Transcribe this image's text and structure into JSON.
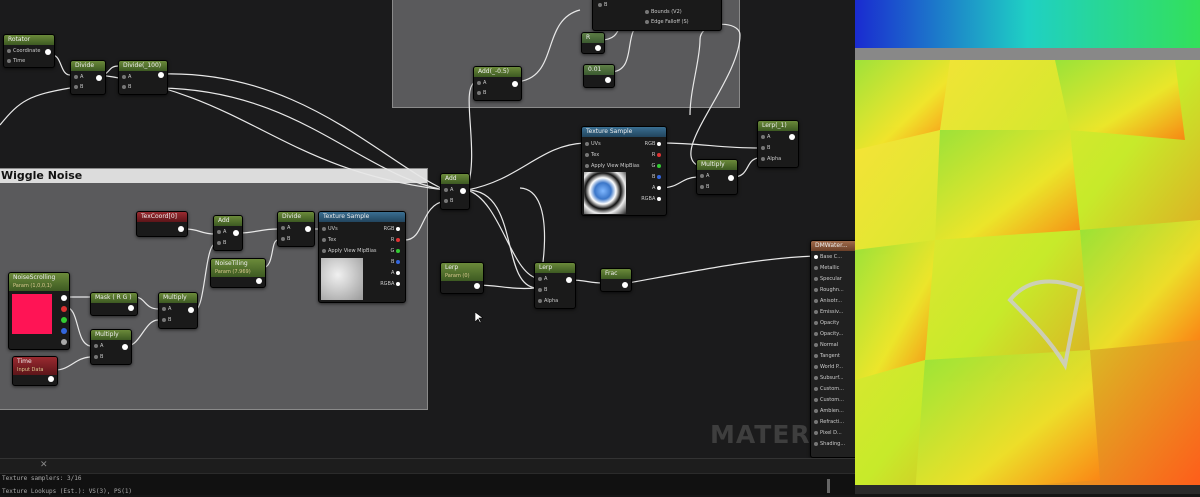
{
  "graph": {
    "watermark": "MATERIAL",
    "comments": [
      {
        "title": "Wiggle Noise"
      }
    ],
    "nodes": {
      "rotator": {
        "title": "Rotator",
        "inputs": [
          "Coordinate",
          "Time"
        ]
      },
      "divide1": {
        "title": "Divide",
        "inputs": [
          "A",
          "B"
        ]
      },
      "divide100": {
        "title": "Divide(_100)",
        "inputs": [
          "A",
          "B"
        ]
      },
      "add05": {
        "title": "Add(_-0.5)",
        "inputs": [
          "A",
          "B"
        ]
      },
      "const_r": {
        "title": "R"
      },
      "const_001": {
        "title": "0.01"
      },
      "sphere_mask": {
        "inputs": [
          "B",
          "Bounds (V2)",
          "Edge Falloff (S)"
        ]
      },
      "texsample_main": {
        "title": "Texture Sample",
        "inputs": [
          "UVs",
          "Tex",
          "Apply View MipBias"
        ],
        "outputs": [
          "RGB",
          "R",
          "G",
          "B",
          "A",
          "RGBA"
        ]
      },
      "lerp_top": {
        "title": "Lerp(_1)",
        "inputs": [
          "A",
          "B",
          "Alpha"
        ]
      },
      "multiply_top": {
        "title": "Multiply",
        "inputs": [
          "A",
          "B"
        ]
      },
      "add_mid": {
        "title": "Add",
        "inputs": [
          "A",
          "B"
        ]
      },
      "texcoord": {
        "title": "TexCoord[0]"
      },
      "add_inner": {
        "title": "Add",
        "inputs": [
          "A",
          "B"
        ]
      },
      "divide_inner": {
        "title": "Divide",
        "inputs": [
          "A",
          "B"
        ]
      },
      "texsample_noise": {
        "title": "Texture Sample",
        "inputs": [
          "UVs",
          "Tex",
          "Apply View MipBias"
        ],
        "outputs": [
          "RGB",
          "R",
          "G",
          "B",
          "A",
          "RGBA"
        ]
      },
      "noise_tiling": {
        "title": "NoiseTiling",
        "sub": "Param (7.969)"
      },
      "noise_scrolling": {
        "title": "NoiseScrolling",
        "sub": "Param (1,0,0,1)"
      },
      "mask_rg": {
        "title": "Mask ( R G )"
      },
      "multiply_inner1": {
        "title": "Multiply",
        "inputs": [
          "A",
          "B"
        ]
      },
      "multiply_inner2": {
        "title": "Multiply",
        "inputs": [
          "A",
          "B"
        ]
      },
      "time": {
        "title": "Time",
        "sub": "Input Data"
      },
      "lerp_param": {
        "title": "Lerp",
        "sub": "Param (0)"
      },
      "lerp_main": {
        "title": "Lerp",
        "inputs": [
          "A",
          "B",
          "Alpha"
        ]
      },
      "frac": {
        "title": "Frac"
      },
      "material_result": {
        "title": "DMWater...",
        "inputs": [
          "Base C...",
          "Metallic",
          "Specular",
          "Roughn...",
          "Anisotr...",
          "Emissiv...",
          "Opacity",
          "Opacity...",
          "Normal",
          "Tangent",
          "World P...",
          "Subsurf...",
          "Custom...",
          "Custom...",
          "Ambien...",
          "Refracti...",
          "Pixel D...",
          "Shading..."
        ]
      }
    }
  },
  "console": {
    "lines": [
      "Texture samplers: 3/16",
      "Texture Lookups (Est.): VS(3), PS(1)"
    ]
  },
  "colors": {
    "node_header_green": "#6b8a3a",
    "node_header_blue": "#3a6f92",
    "node_header_red": "#9a2a30",
    "noise_scrolling_preview": "#ff1455",
    "graph_background": "#1b1b1c",
    "comment_body": "#5a5a5c"
  }
}
